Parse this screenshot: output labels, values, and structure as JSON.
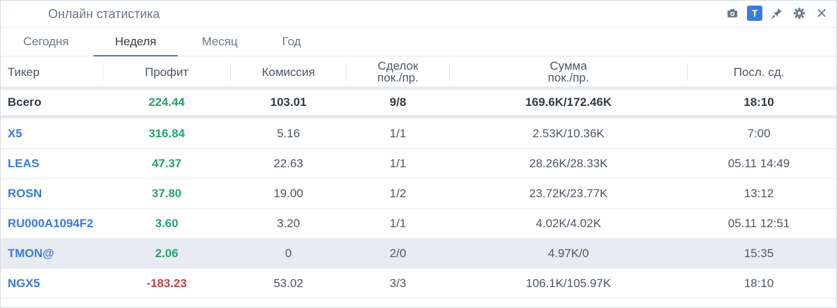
{
  "window": {
    "title": "Онлайн статистика"
  },
  "toolbar": {
    "icons": [
      "camera-icon",
      "t-icon",
      "pin-icon",
      "gear-icon",
      "close-icon"
    ],
    "t_label": "T",
    "close_glyph": "✕"
  },
  "tabs": [
    {
      "label": "Сегодня",
      "active": false
    },
    {
      "label": "Неделя",
      "active": true
    },
    {
      "label": "Месяц",
      "active": false
    },
    {
      "label": "Год",
      "active": false
    }
  ],
  "table": {
    "headers": {
      "ticker": "Тикер",
      "profit": "Профит",
      "commission": "Комиссия",
      "deals_1": "Сделок",
      "deals_2": "пок./пр.",
      "sum_1": "Сумма",
      "sum_2": "пок./пр.",
      "last": "Посл. сд."
    },
    "total": {
      "ticker": "Всего",
      "profit": "224.44",
      "commission": "103.01",
      "deals": "9/8",
      "sum": "169.6K/172.46K",
      "last": "18:10"
    },
    "rows": [
      {
        "ticker": "X5",
        "profit": "316.84",
        "commission": "5.16",
        "deals": "1/1",
        "sum": "2.53K/10.36K",
        "last": "7:00",
        "sign": "pos"
      },
      {
        "ticker": "LEAS",
        "profit": "47.37",
        "commission": "22.63",
        "deals": "1/1",
        "sum": "28.26K/28.33K",
        "last": "05.11 14:49",
        "sign": "pos"
      },
      {
        "ticker": "ROSN",
        "profit": "37.80",
        "commission": "19.00",
        "deals": "1/2",
        "sum": "23.72K/23.77K",
        "last": "13:12",
        "sign": "pos"
      },
      {
        "ticker": "RU000A1094F2",
        "profit": "3.60",
        "commission": "3.20",
        "deals": "1/1",
        "sum": "4.02K/4.02K",
        "last": "05.11 12:51",
        "sign": "pos"
      },
      {
        "ticker": "TMON@",
        "profit": "2.06",
        "commission": "0",
        "deals": "2/0",
        "sum": "4.97K/0",
        "last": "15:35",
        "sign": "pos",
        "highlighted": true
      },
      {
        "ticker": "NGX5",
        "profit": "-183.23",
        "commission": "53.02",
        "deals": "3/3",
        "sum": "106.1K/105.97K",
        "last": "18:10",
        "sign": "neg"
      }
    ]
  },
  "colors": {
    "accent": "#3b7ddd",
    "positive": "#27a36a",
    "negative": "#c2414b",
    "ticker": "#3a7bd5"
  }
}
